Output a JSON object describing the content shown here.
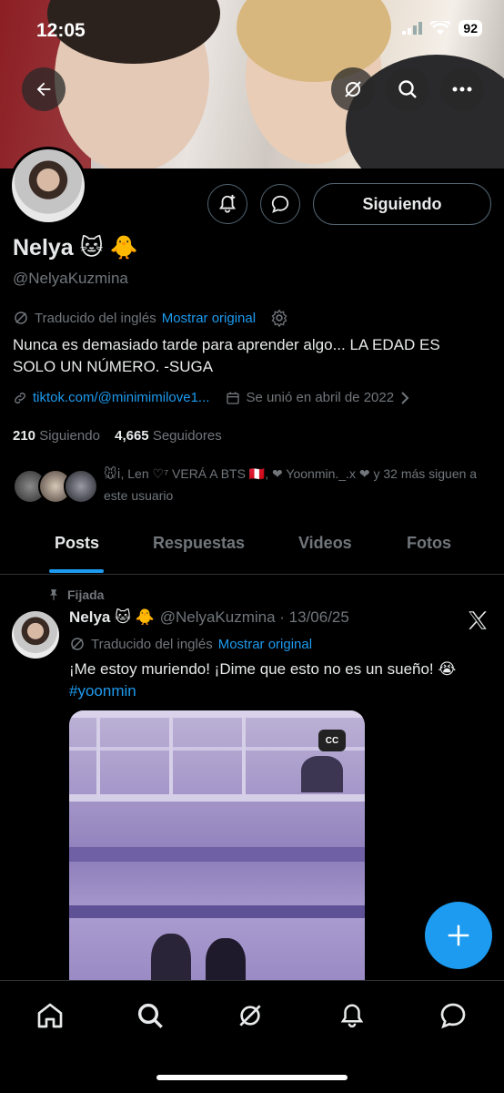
{
  "status_bar": {
    "time": "12:05",
    "battery": "92"
  },
  "profile": {
    "name": "Nelya 🐱 🐥",
    "handle": "@NelyaKuzmina",
    "translated_label": "Traducido del inglés",
    "show_original": "Mostrar original",
    "bio": "Nunca es demasiado tarde para aprender algo... LA EDAD ES SOLO UN NÚMERO. -SUGA",
    "link": "tiktok.com/@minimimilove1...",
    "joined": "Se unió en abril de 2022",
    "following_count": "210",
    "following_label": "Siguiendo",
    "followers_count": "4,665",
    "followers_label": "Seguidores",
    "followed_by": "🐭ⅰ, Len ♡⁷ VERÁ A BTS 🇵🇪, ❤ Yoonmin._.x ❤ y 32 más siguen a este usuario",
    "follow_button": "Siguiendo"
  },
  "tabs": [
    {
      "label": "Posts"
    },
    {
      "label": "Respuestas"
    },
    {
      "label": "Videos"
    },
    {
      "label": "Fotos"
    }
  ],
  "post": {
    "pinned_label": "Fijada",
    "author": "Nelya 🐱 🐥",
    "handle_date": "@NelyaKuzmina · 13/06/25",
    "translated_label": "Traducido del inglés",
    "show_original": "Mostrar original",
    "text": "¡Me estoy muriendo! ¡Dime que esto no es un sueño! 😭",
    "hashtag": "#yoonmin",
    "cc_label": "CC"
  },
  "colors": {
    "accent": "#1d9bf0",
    "background": "#000000",
    "muted": "#71767b",
    "text": "#e7e9ea"
  },
  "icons": {
    "back": "arrow-left-icon",
    "grok": "grok-icon",
    "search": "search-icon",
    "more": "more-icon",
    "notify": "bell-plus-icon",
    "message": "message-icon",
    "x_logo": "x-logo-icon",
    "compose": "plus-icon",
    "nav": [
      "home-icon",
      "search-icon",
      "grok-icon",
      "bell-icon",
      "message-icon"
    ]
  }
}
